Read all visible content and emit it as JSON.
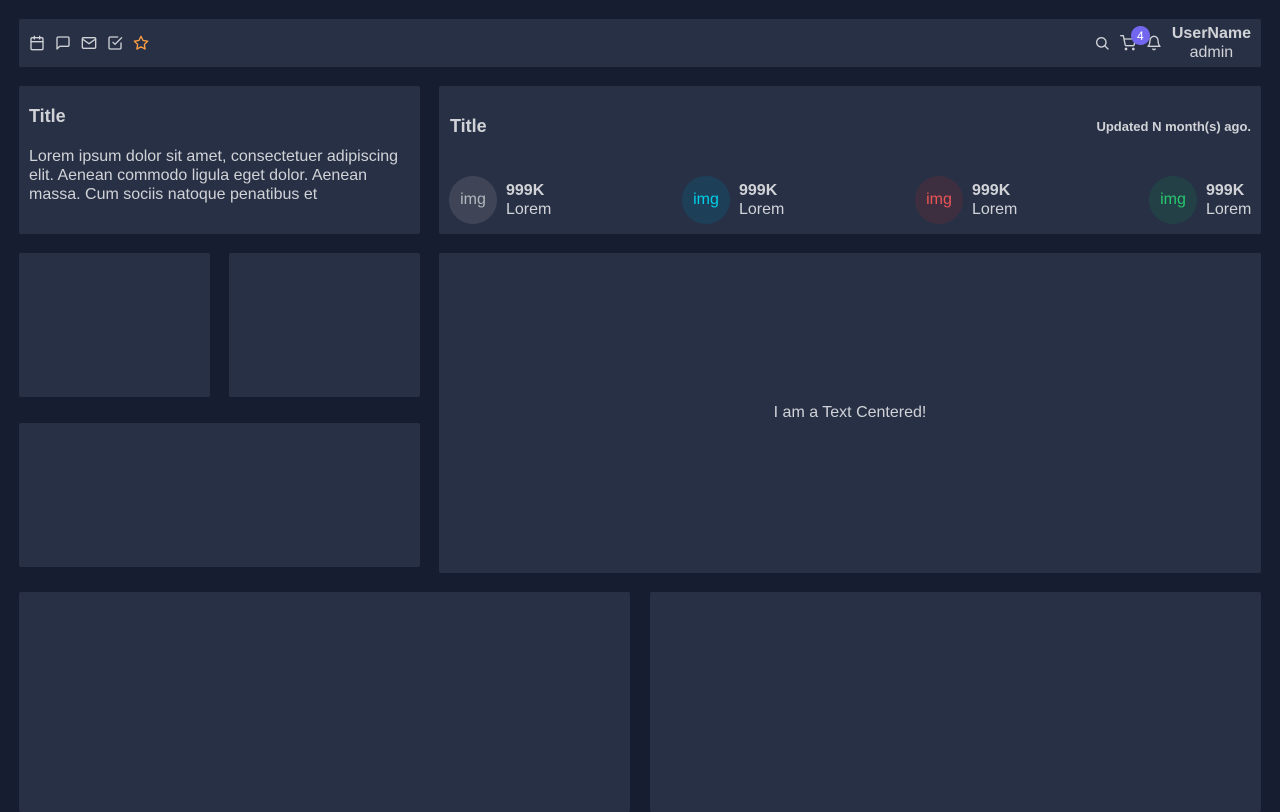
{
  "navbar": {
    "left_icons": [
      "calendar-icon",
      "message-icon",
      "mail-icon",
      "check-square-icon",
      "star-icon"
    ],
    "cart_count": "4",
    "user": {
      "name": "UserName",
      "role": "admin"
    }
  },
  "text_card": {
    "title": "Title",
    "body": "Lorem ipsum dolor sit amet, consectetuer adipiscing elit. Aenean commodo ligula eget dolor. Aenean massa. Cum sociis natoque penatibus et"
  },
  "stats_card": {
    "title": "Title",
    "updated": "Updated N month(s) ago.",
    "items": [
      {
        "img": "img",
        "value": "999K",
        "label": "Lorem",
        "color": "#b4b7bd",
        "bg": "#3f4556"
      },
      {
        "img": "img",
        "value": "999K",
        "label": "Lorem",
        "color": "#00cfe8",
        "bg": "#1e3f58"
      },
      {
        "img": "img",
        "value": "999K",
        "label": "Lorem",
        "color": "#ea5455",
        "bg": "#3e2f40"
      },
      {
        "img": "img",
        "value": "999K",
        "label": "Lorem",
        "color": "#28c76f",
        "bg": "#224046"
      }
    ]
  },
  "center_card": {
    "text": "I am a Text Centered!"
  },
  "colors": {
    "background": "#161d31",
    "card": "#283046",
    "accent": "#7367f0",
    "star": "#ff9f43"
  }
}
